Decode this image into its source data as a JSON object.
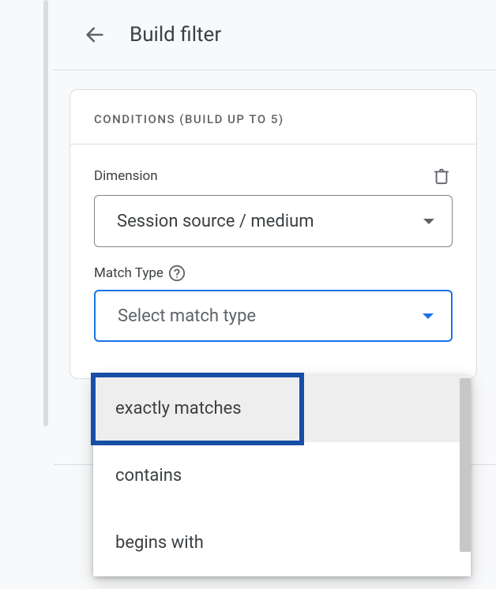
{
  "header": {
    "title": "Build filter"
  },
  "conditions": {
    "section_label": "CONDITIONS (BUILD UP TO 5)",
    "dimension_label": "Dimension",
    "dimension_value": "Session source / medium",
    "match_type_label": "Match Type",
    "match_type_placeholder": "Select match type",
    "options": [
      {
        "label": "exactly matches"
      },
      {
        "label": "contains"
      },
      {
        "label": "begins with"
      }
    ]
  }
}
